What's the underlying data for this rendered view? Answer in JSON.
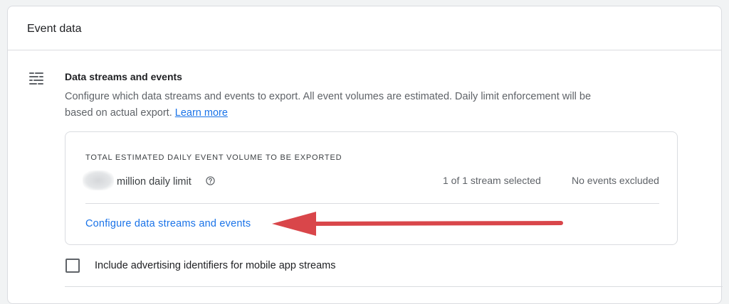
{
  "card": {
    "title": "Event data"
  },
  "section": {
    "icon": "data-streams-icon",
    "title": "Data streams and events",
    "description": "Configure which data streams and events to export. All event volumes are estimated. Daily limit enforcement will be based on actual export.",
    "learn_more": "Learn more"
  },
  "volume": {
    "label": "TOTAL ESTIMATED DAILY EVENT VOLUME TO BE EXPORTED",
    "limit_text": "million daily limit",
    "help_icon": "help-circle-icon",
    "streams_selected": "1 of 1 stream selected",
    "events_excluded": "No events excluded",
    "configure_link": "Configure data streams and events",
    "arrow_color": "#d9464a"
  },
  "options": {
    "advertising_ids_label": "Include advertising identifiers for mobile app streams",
    "advertising_ids_checked": false
  },
  "colors": {
    "link": "#1a73e8",
    "border": "#dadce0",
    "text": "#202124",
    "secondary_text": "#5f6368"
  }
}
